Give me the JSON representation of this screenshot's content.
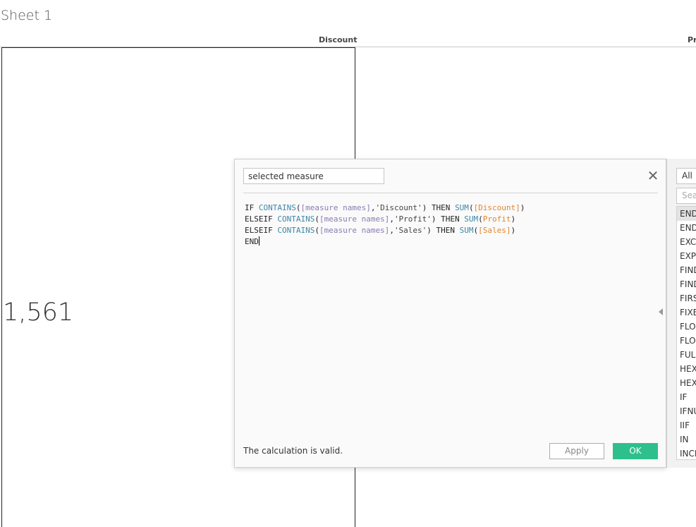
{
  "sheet": {
    "title": "Sheet 1",
    "columns": [
      "Discount",
      "Pr"
    ],
    "value": "1,561"
  },
  "calc_dialog": {
    "name": "selected measure",
    "code_lines": [
      "IF CONTAINS([measure names],'Discount') THEN SUM([Discount])",
      "ELSEIF CONTAINS([measure names],'Profit') THEN SUM(Profit)",
      "ELSEIF CONTAINS([measure names],'Sales') THEN SUM([Sales])",
      "END"
    ],
    "status": "The calculation is valid.",
    "apply_label": "Apply",
    "ok_label": "OK"
  },
  "function_panel": {
    "filter": "All",
    "search_placeholder": "Sea",
    "items": [
      "END",
      "END",
      "EXC",
      "EXP",
      "FIND",
      "FIND",
      "FIRS",
      "FIXE",
      "FLO",
      "FLO",
      "FUL",
      "HEX",
      "HEX",
      "IF",
      "IFNU",
      "IIF",
      "IN",
      "INCI"
    ],
    "selected_index": 0
  },
  "colors": {
    "ok_button": "#2dc08d",
    "function_token": "#3d87a8",
    "measure_names_token": "#8a7bb5",
    "field_token": "#e0852e"
  }
}
